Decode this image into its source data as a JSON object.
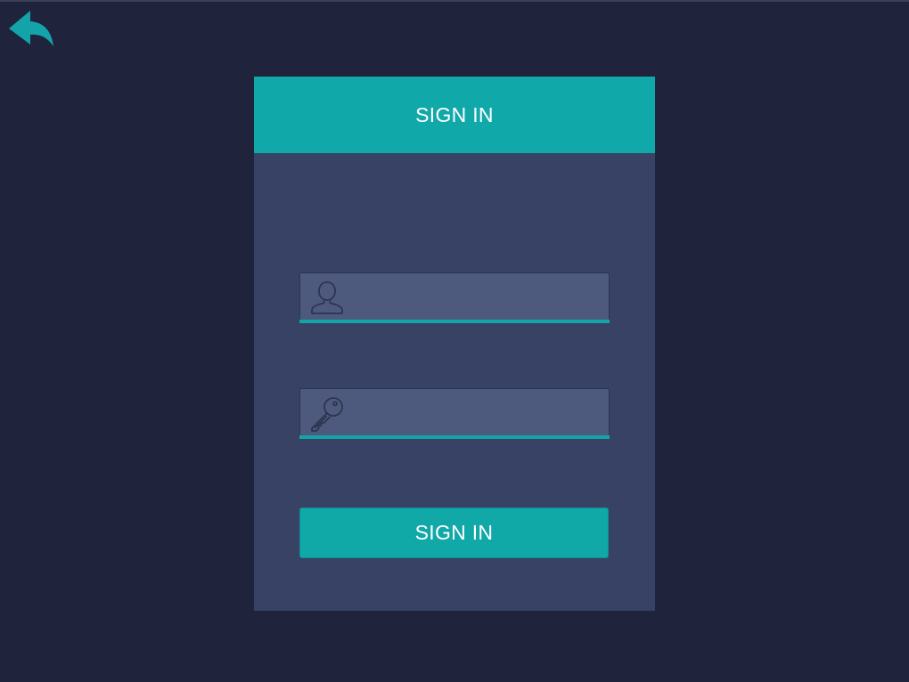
{
  "colors": {
    "background": "#1f233c",
    "card": "#384264",
    "accent": "#11a8aa",
    "field": "#4e5a7d"
  },
  "nav": {
    "back_icon": "reply-arrow-icon"
  },
  "form": {
    "title": "SIGN IN",
    "username": {
      "icon": "user-icon",
      "value": "",
      "placeholder": ""
    },
    "password": {
      "icon": "key-icon",
      "value": "",
      "placeholder": ""
    },
    "submit_label": "SIGN IN"
  }
}
